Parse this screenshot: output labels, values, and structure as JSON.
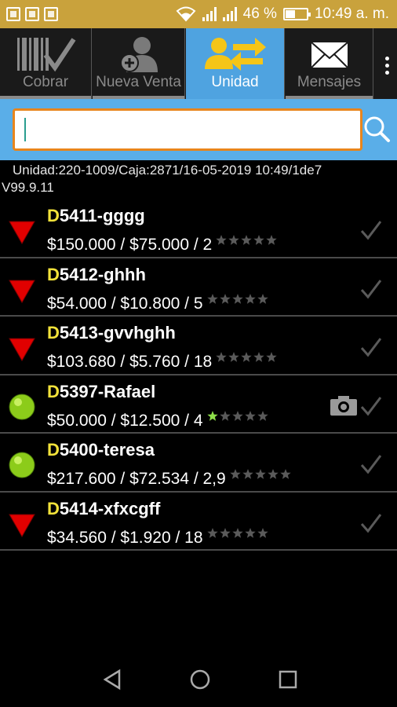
{
  "status_bar": {
    "battery_percent": "46 %",
    "time": "10:49 a. m."
  },
  "tabs": [
    {
      "label": "Cobrar",
      "active": false
    },
    {
      "label": "Nueva Venta",
      "active": false
    },
    {
      "label": "Unidad",
      "active": true
    },
    {
      "label": "Mensajes",
      "active": false
    }
  ],
  "search": {
    "value": "",
    "placeholder": ""
  },
  "info": {
    "line1": "Unidad:220-1009/Caja:2871/16-05-2019 10:49/1de7",
    "line2": "V99.9.11"
  },
  "rows": [
    {
      "prefix": "D",
      "name": "5411-gggg",
      "amount": "$150.000 / $75.000 / 2",
      "status": "red-triangle-icon",
      "stars_filled": 0,
      "photo": false
    },
    {
      "prefix": "D",
      "name": "5412-ghhh",
      "amount": "$54.000 / $10.800 / 5",
      "status": "red-triangle-icon",
      "stars_filled": 0,
      "photo": false
    },
    {
      "prefix": "D",
      "name": "5413-gvvhghh",
      "amount": "$103.680 / $5.760 / 18",
      "status": "red-triangle-icon",
      "stars_filled": 0,
      "photo": false
    },
    {
      "prefix": "D",
      "name": "5397-Rafael",
      "amount": "$50.000 / $12.500 / 4",
      "status": "green-circle-icon",
      "stars_filled": 1,
      "photo": true
    },
    {
      "prefix": "D",
      "name": "5400-teresa",
      "amount": "$217.600 / $72.534 / 2,9",
      "status": "green-circle-icon",
      "stars_filled": 0,
      "photo": false
    },
    {
      "prefix": "D",
      "name": "5414-xfxcgff",
      "amount": "$34.560 / $1.920 / 18",
      "status": "red-triangle-icon",
      "stars_filled": 0,
      "photo": false
    }
  ],
  "colors": {
    "status_bar": "#c9a23c",
    "tab_active": "#4fa3e0",
    "search_band": "#5aaee8",
    "search_border": "#e8851c",
    "prefix_yellow": "#f2e23a",
    "star_active": "#8fe04a"
  }
}
